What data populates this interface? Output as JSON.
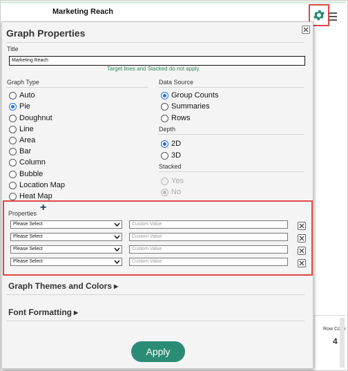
{
  "background": {
    "chart_title": "Marketing Reach",
    "row_count_label": "Row Coun",
    "row_count_value": "4"
  },
  "panel": {
    "title": "Graph Properties",
    "title_field": {
      "label": "Title",
      "value": "Marketing Reach"
    },
    "note": "Target lines and Stacked do not apply.",
    "graph_type": {
      "label": "Graph Type",
      "options": [
        "Auto",
        "Pie",
        "Doughnut",
        "Line",
        "Area",
        "Bar",
        "Column",
        "Bubble",
        "Location Map",
        "Heat Map"
      ],
      "selected": "Pie"
    },
    "data_source": {
      "label": "Data Source",
      "options": [
        "Group Counts",
        "Summaries",
        "Rows"
      ],
      "selected": "Group Counts"
    },
    "depth": {
      "label": "Depth",
      "options": [
        "2D",
        "3D"
      ],
      "selected": "2D"
    },
    "stacked": {
      "label": "Stacked",
      "options": [
        "Yes",
        "No"
      ],
      "selected": "No"
    },
    "properties": {
      "label": "Properties",
      "rows": [
        {
          "select": "Please Select",
          "placeholder": "Custom Value"
        },
        {
          "select": "Please Select",
          "placeholder": "Custom Value"
        },
        {
          "select": "Please Select",
          "placeholder": "Custom Value"
        },
        {
          "select": "Please Select",
          "placeholder": "Custom Value"
        }
      ]
    },
    "themes_label": "Graph Themes and Colors",
    "font_label": "Font Formatting",
    "apply_label": "Apply"
  },
  "colors": {
    "accent": "#2b8c76",
    "highlight": "#e04646",
    "radio_selected": "#1a73e8"
  }
}
